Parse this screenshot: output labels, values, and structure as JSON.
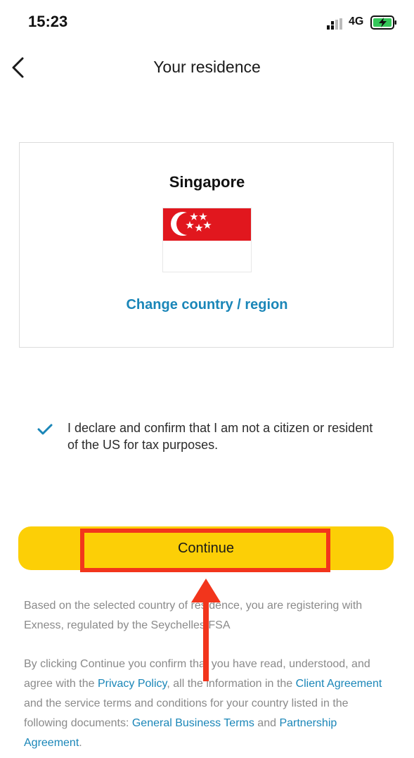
{
  "status_bar": {
    "time": "15:23",
    "network": "4G",
    "icons": [
      "signal-icon",
      "battery-charging-icon"
    ]
  },
  "header": {
    "title": "Your residence",
    "back_icon": "chevron-left-icon"
  },
  "country": {
    "name": "Singapore",
    "flag_icon": "singapore-flag-icon",
    "change_link": "Change country / region"
  },
  "declaration": {
    "checked": true,
    "text": "I declare and confirm that I am not a citizen or resident of the US for tax purposes."
  },
  "continue_button": {
    "label": "Continue"
  },
  "legal": {
    "paragraph1": "Based on the selected country of residence, you are registering with Exness, regulated by the Seychelles FSA",
    "paragraph2": {
      "part1": "By clicking Continue you confirm that you have read, understood, and agree with the ",
      "privacy_link": "Privacy Policy",
      "part2": ", all the information in the ",
      "client_agreement_link": "Client Agreement",
      "part3": " and the service terms and conditions for your country listed in the following documents: ",
      "business_terms_link": "General Business Terms",
      "part4": " and ",
      "partnership_link": "Partnership Agreement",
      "part5": "."
    }
  },
  "colors": {
    "accent": "#fccf06",
    "link": "#1a86b8",
    "annotation": "#f2351c",
    "flag_red": "#e1171e"
  }
}
